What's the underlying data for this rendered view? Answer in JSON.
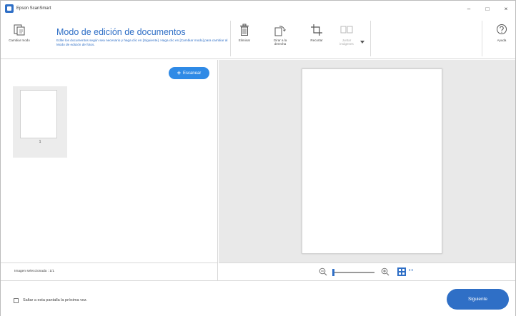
{
  "window": {
    "title": "Epson ScanSmart",
    "minimize": "–",
    "maximize": "□",
    "close": "×"
  },
  "toolbar": {
    "change_mode": "Cambiar modo",
    "mode_title": "Modo de edición de documentos",
    "mode_desc": "Edite los documentos según sea necesario y haga clic en [Siguiente]. Haga clic en [Cambiar modo] para cambiar al Modo de edición de fotos.",
    "delete": "Eliminar",
    "rotate_right": "Girar a la derecha",
    "crop": "Recortar",
    "merge_images": "Juntar imágenes",
    "help": "Ayuda"
  },
  "left_pane": {
    "scan_button": "Escanear",
    "thumbnails": [
      {
        "number": "1"
      }
    ],
    "status": "Imagen seleccionada : 1/1"
  },
  "zoom": {
    "level": 0,
    "more": "••"
  },
  "footer": {
    "skip_label": "Saltar a esta pantalla la próxima vez.",
    "skip_checked": false,
    "next_button": "Siguiente"
  },
  "colors": {
    "accent": "#2f6fc6",
    "scan_button": "#2f8ae6",
    "preview_bg": "#e9e9e9"
  }
}
